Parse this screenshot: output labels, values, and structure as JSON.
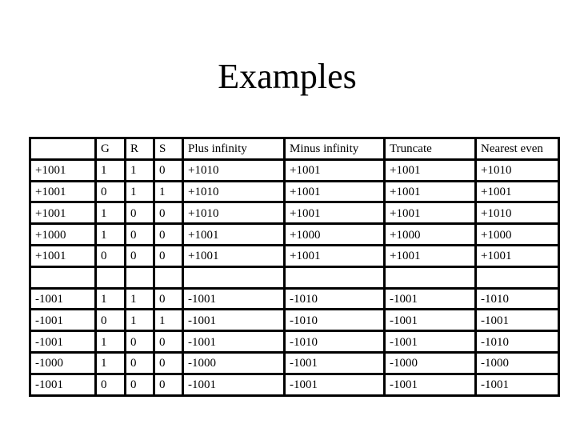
{
  "slide": {
    "title": "Examples"
  },
  "table": {
    "headers": [
      "",
      "G",
      "R",
      "S",
      "Plus infinity",
      "Minus infinity",
      "Truncate",
      "Nearest even"
    ],
    "rows": [
      [
        "+1001",
        "1",
        "1",
        "0",
        "+1010",
        "+1001",
        "+1001",
        "+1010"
      ],
      [
        "+1001",
        "0",
        "1",
        "1",
        "+1010",
        "+1001",
        "+1001",
        "+1001"
      ],
      [
        "+1001",
        "1",
        "0",
        "0",
        "+1010",
        "+1001",
        "+1001",
        "+1010"
      ],
      [
        "+1000",
        "1",
        "0",
        "0",
        "+1001",
        "+1000",
        "+1000",
        "+1000"
      ],
      [
        "+1001",
        "0",
        "0",
        "0",
        "+1001",
        "+1001",
        "+1001",
        "+1001"
      ],
      [
        "",
        "",
        "",
        "",
        "",
        "",
        "",
        ""
      ],
      [
        "-1001",
        "1",
        "1",
        "0",
        "-1001",
        "-1010",
        "-1001",
        "-1010"
      ],
      [
        "-1001",
        "0",
        "1",
        "1",
        "-1001",
        "-1010",
        "-1001",
        "-1001"
      ],
      [
        "-1001",
        "1",
        "0",
        "0",
        "-1001",
        "-1010",
        "-1001",
        "-1010"
      ],
      [
        "-1000",
        "1",
        "0",
        "0",
        "-1000",
        "-1001",
        "-1000",
        "-1000"
      ],
      [
        "-1001",
        "0",
        "0",
        "0",
        "-1001",
        "-1001",
        "-1001",
        "-1001"
      ]
    ]
  }
}
